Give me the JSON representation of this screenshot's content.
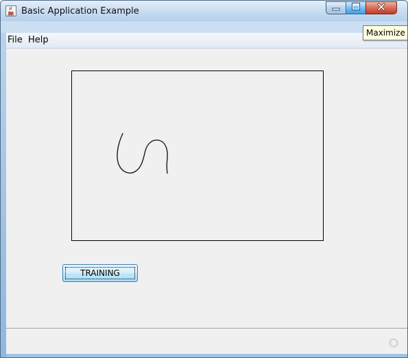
{
  "window": {
    "title": "Basic Application Example",
    "tooltip": "Maximize"
  },
  "menu": {
    "items": [
      "File",
      "Help"
    ]
  },
  "main": {
    "button_label": "TRAINING"
  },
  "colors": {
    "titlebar": "#c9ddf1",
    "content_bg": "#f0f0f0",
    "tooltip_bg": "#ffffe1",
    "button_border": "#3c7fb1"
  },
  "icons": {
    "app": "java-cup-icon",
    "minimize": "minimize-icon",
    "maximize": "maximize-icon",
    "close": "close-icon",
    "status": "busy-indicator-icon"
  }
}
